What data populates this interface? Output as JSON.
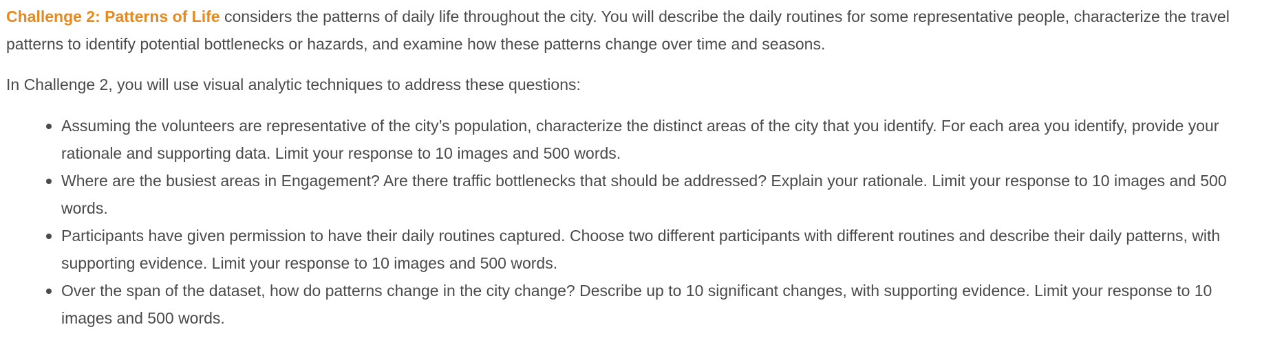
{
  "intro": {
    "title": "Challenge 2: Patterns of Life",
    "text": " considers the patterns of daily life throughout the city. You will describe the daily routines for some representative people, characterize the travel patterns to identify potential bottlenecks or hazards, and examine how these patterns change over time and seasons."
  },
  "question_intro": "In Challenge 2, you will use visual analytic techniques to address these questions:",
  "questions": [
    "Assuming the volunteers are representative of the city’s population, characterize the distinct areas of the city that you identify. For each area you identify, provide your rationale and supporting data. Limit your response to 10 images and 500 words.",
    "Where are the busiest areas in Engagement? Are there traffic bottlenecks that should be addressed? Explain your rationale. Limit your response to 10 images and 500 words.",
    "Participants have given permission to have their daily routines captured. Choose two different participants with different routines and describe their daily patterns, with supporting evidence. Limit your response to 10 images and 500 words.",
    "Over the span of the dataset, how do patterns change in the city change? Describe up to 10 significant changes, with supporting evidence. Limit your response to 10 images and 500 words."
  ],
  "colors": {
    "accent": "#e8891d",
    "text": "#4a4a4a"
  }
}
